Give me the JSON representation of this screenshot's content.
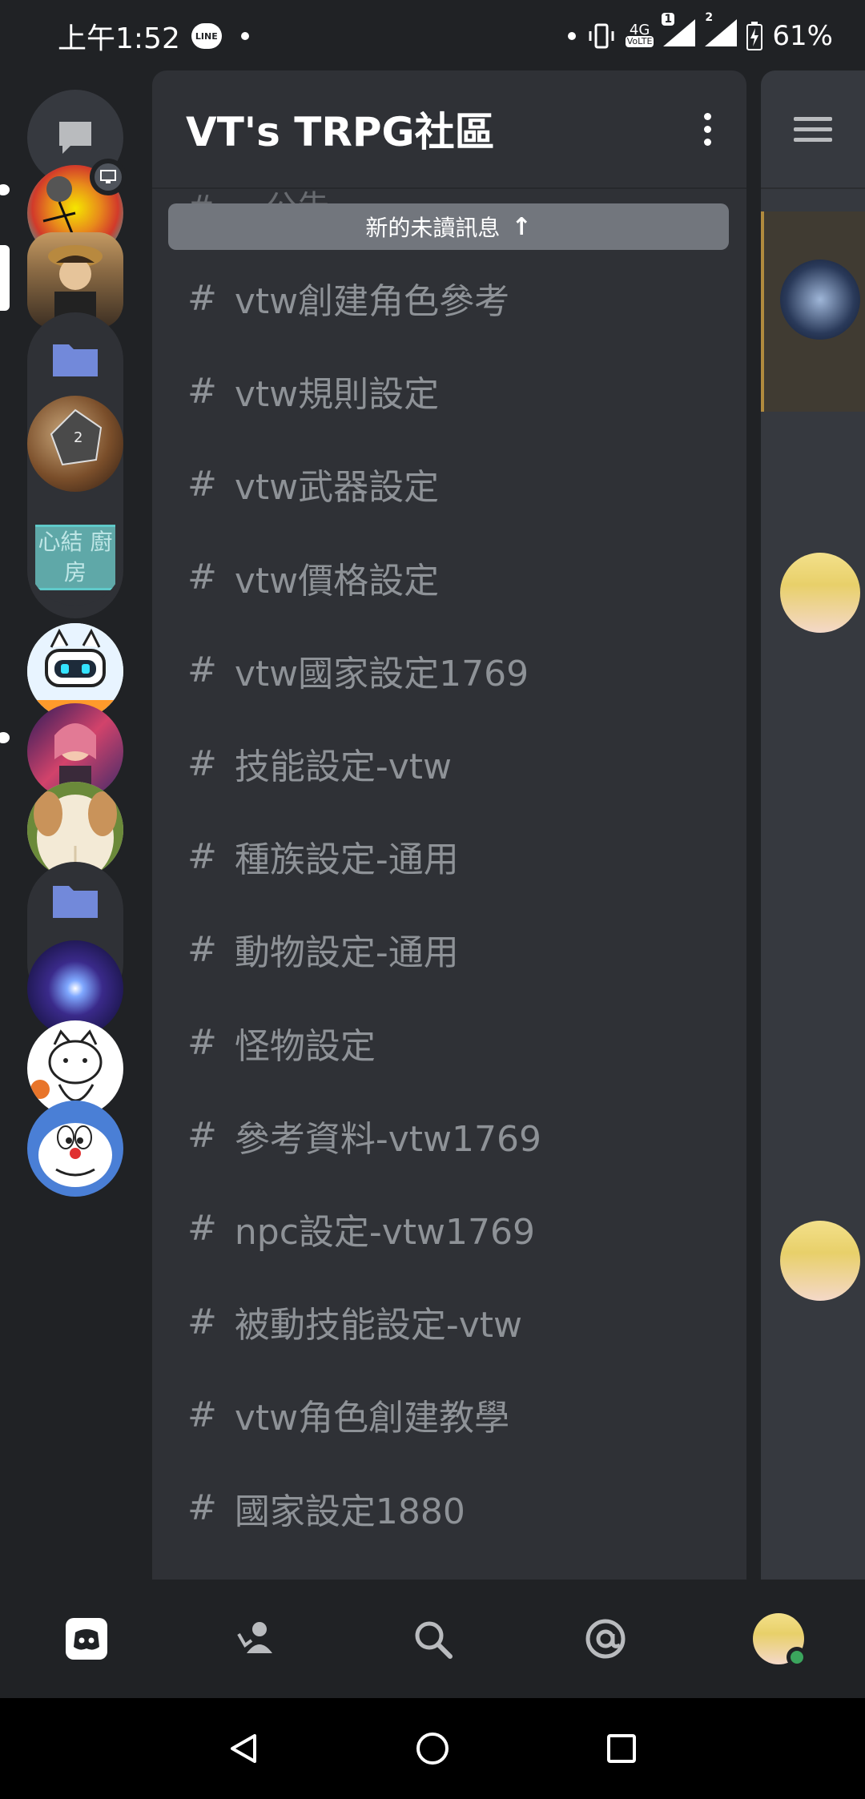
{
  "status_bar": {
    "time": "上午1:52",
    "line_label": "LINE",
    "network_label": "4G",
    "volte_label": "VoLTE",
    "sim1": "1",
    "sim2": "2",
    "battery": "61%"
  },
  "server": {
    "name": "VT's TRPG社區"
  },
  "unread_banner": {
    "label": "新的未讀訊息",
    "arrow": "↑"
  },
  "partial_channel": "# ... 公告",
  "channels": [
    "vtw創建角色參考",
    "vtw規則設定",
    "vtw武器設定",
    "vtw價格設定",
    "vtw國家設定1769",
    "技能設定-vtw",
    "種族設定-通用",
    "動物設定-通用",
    "怪物設定",
    "參考資料-vtw1769",
    "npc設定-vtw1769",
    "被動技能設定-vtw",
    "vtw角色創建教學",
    "國家設定1880"
  ],
  "rail_labels": {
    "kitchen_server_text": "心結 廚房"
  },
  "tabs": [
    "home",
    "friends",
    "search",
    "mentions",
    "profile"
  ],
  "colors": {
    "background": "#202225",
    "panel": "#2f3136",
    "chat": "#36393f",
    "channel_text": "#8e9297",
    "unread_bar": "#72767d",
    "folder_blue": "#7289da",
    "online_green": "#3ba55d"
  }
}
